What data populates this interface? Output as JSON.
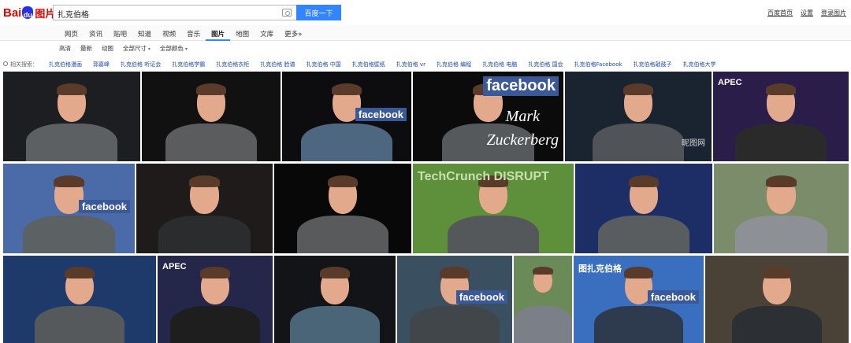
{
  "header": {
    "logo_left": "Bai",
    "logo_right": "图片",
    "logo_paw": "du",
    "search_value": "扎克伯格",
    "search_button": "百度一下",
    "top_links": [
      "百度首页",
      "设置",
      "登录图片"
    ],
    "camera_icon": "camera-icon"
  },
  "nav": {
    "tabs": [
      "网页",
      "资讯",
      "贴吧",
      "知道",
      "视频",
      "音乐",
      "图片",
      "地图",
      "文库",
      "更多»"
    ],
    "active": "图片"
  },
  "filters": [
    "高清",
    "最新",
    "动图",
    "全部尺寸",
    "全部颜色"
  ],
  "related": {
    "label": "相关搜索：",
    "items": [
      "扎克伯格漫画",
      "郭嘉峰",
      "扎克伯格 听证会",
      "扎克伯格学霸",
      "扎克伯格衣柜",
      "扎克伯格 脸谱",
      "扎克伯格 中国",
      "扎克伯格壁纸",
      "扎克伯格 vr",
      "扎克伯格 编程",
      "扎克伯格 电脑",
      "扎克伯格 国会",
      "扎克伯格Facebook",
      "扎克伯格敲鼓子",
      "扎克伯格大学"
    ]
  },
  "tiles": [
    {
      "bg": "#1c1e22",
      "shirt": "#5d6063"
    },
    {
      "bg": "#111111",
      "shirt": "#5a5c5e"
    },
    {
      "bg": "#0d0d10",
      "shirt": "#4d6780",
      "badge": "facebook"
    },
    {
      "bg": "#0b0b0b",
      "shirt": "#55595c",
      "badge": "facebook",
      "caption1": "Mark",
      "caption2": "Zuckerberg"
    },
    {
      "bg": "#1a2330",
      "shirt": "#505458",
      "watermark": "昵图网"
    },
    {
      "bg": "#2a1d4a",
      "shirt": "#2a2a2a",
      "text": "APEC"
    },
    {
      "bg": "#4a6aa8",
      "shirt": "#5c6164",
      "badge": "facebook"
    },
    {
      "bg": "#1e1b1a",
      "shirt": "#2a2c2e"
    },
    {
      "bg": "#080808",
      "shirt": "#585a5c"
    },
    {
      "bg": "#5e8f3a",
      "shirt": "#55585a",
      "text": "TechCrunch DISRUPT"
    },
    {
      "bg": "#1d2e66",
      "shirt": "#5a5d60"
    },
    {
      "bg": "#7a8c6a",
      "shirt": "#8d9094"
    },
    {
      "bg": "#1e3a6a",
      "shirt": "#55595c"
    },
    {
      "bg": "#24264a",
      "shirt": "#1e1e1e",
      "text": "APEC"
    },
    {
      "bg": "#121418",
      "shirt": "#4a6478"
    },
    {
      "bg": "#3a5060",
      "shirt": "#41464a",
      "badge": "facebook"
    },
    {
      "bg": "#6a8a58",
      "shirt": "#7b7f88"
    },
    {
      "bg": "#3a6fc0",
      "shirt": "#2e3a4e",
      "badge": "facebook",
      "text": "图扎克伯格"
    },
    {
      "bg": "#4a4236",
      "shirt": "#2c2f33"
    }
  ],
  "colors": {
    "accent": "#3385ff",
    "link": "#1b49b8",
    "facebook": "#3b5998"
  }
}
